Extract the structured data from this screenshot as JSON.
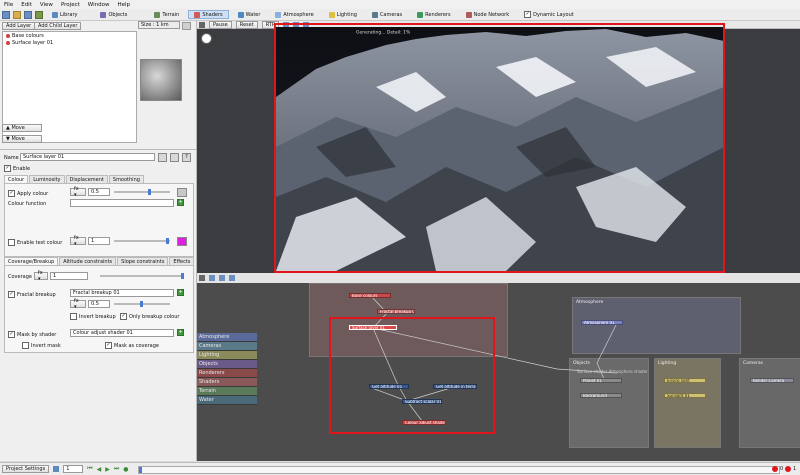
{
  "menu": [
    "File",
    "Edit",
    "View",
    "Project",
    "Window",
    "Help"
  ],
  "toolbar": {
    "buttons": [
      "Library",
      "Objects",
      "Terrain",
      "Shaders",
      "Water",
      "Atmosphere",
      "Lighting",
      "Cameras",
      "Renderers",
      "Node Network",
      "Dynamic Layout"
    ],
    "active": "Shaders"
  },
  "layers": {
    "add_layer": "Add Layer",
    "add_child_layer": "Add Child Layer",
    "items": [
      "Base colours",
      "Surface layer 01"
    ],
    "size_label": "Size : 1 km",
    "move_up": "Move",
    "move_down": "Move"
  },
  "props": {
    "name_label": "Name",
    "name_value": "Surface layer 01",
    "enable_label": "Enable",
    "tabs": [
      "Colour",
      "Luminosity",
      "Displacement",
      "Smoothing"
    ],
    "apply_colour_label": "Apply colour",
    "apply_colour_value": "0.5",
    "colour_function_label": "Colour function",
    "enable_test_colour_label": "Enable test colour",
    "test_colour_value": "1",
    "tabs2": [
      "Coverage/Breakup",
      "Altitude constraints",
      "Slope constraints",
      "Effects"
    ],
    "coverage_label": "Coverage",
    "coverage_value": "1",
    "fractal_breakup_label": "Fractal breakup",
    "fractal_breakup_value": "Fractal breakup 01",
    "fractal_value": "0.5",
    "invert_breakup_label": "Invert breakup",
    "only_breakup_colour_label": "Only breakup colour",
    "mask_by_shader_label": "Mask by shader",
    "mask_by_shader_value": "Colour adjust shader 01",
    "invert_mask_label": "Invert mask",
    "mask_as_coverage_label": "Mask as coverage"
  },
  "viewport": {
    "pause": "Pause",
    "reset": "Reset",
    "rtp": "RTP",
    "status": "Generating... Detail: 1%"
  },
  "nodenet": {
    "categories": [
      {
        "label": "Atmosphere",
        "color": "#5a6a9a"
      },
      {
        "label": "Cameras",
        "color": "#5a7a8a"
      },
      {
        "label": "Lighting",
        "color": "#8a8a5a"
      },
      {
        "label": "Objects",
        "color": "#6a5a8a"
      },
      {
        "label": "Renderers",
        "color": "#8a4a4a"
      },
      {
        "label": "Shaders",
        "color": "#8a5a5a"
      },
      {
        "label": "Terrain",
        "color": "#5a7a5a"
      },
      {
        "label": "Water",
        "color": "#4a6a7a"
      }
    ],
    "groups": {
      "atmosphere": "Atmosphere",
      "objects": "Objects",
      "lighting": "Lighting",
      "cameras": "Cameras"
    },
    "nodes": {
      "base_colours": "Base colours",
      "fractal_breakup": "Fractal breakup 01",
      "surface_layer": "Surface layer 01",
      "get_altitude": "Get altitude 01",
      "get_altitude_terrain": "Get altitude in terrain",
      "subtract": "Subtract scalar 01",
      "colour_adjust": "Colour adjust shader",
      "atmosphere": "Atmosphere 01",
      "planet": "Planet 01",
      "background": "Background",
      "enviro_light": "Enviro light",
      "sunlight": "Sunlight 01",
      "render_camera": "Render Camera"
    },
    "hint": "Surface shader  Atmosphere shader"
  },
  "status": {
    "project_settings": "Project Settings",
    "frame": "1",
    "error_count": "0",
    "warn_count": "1"
  },
  "colors": {
    "highlight": "#e0161c",
    "accent": "#4a7bd0"
  }
}
